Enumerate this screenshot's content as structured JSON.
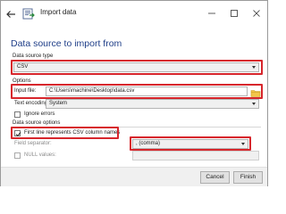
{
  "window": {
    "title": "Import data"
  },
  "heading": "Data source to import from",
  "data_source_type": {
    "section_label": "Data source type",
    "selected": "CSV"
  },
  "options": {
    "section_label": "Options",
    "input_file_label": "Input file:",
    "input_file_value": "C:\\Users\\machine\\Desktop\\data.csv",
    "text_encoding_label": "Text encoding:",
    "text_encoding_value": "System",
    "ignore_errors_label": "Ignore errors"
  },
  "data_source_options": {
    "section_label": "Data source options",
    "first_line_label": "First line represents CSV column names",
    "field_separator_label": "Field separator:",
    "field_separator_value": ", (comma)",
    "null_values_label": "NULL values:",
    "null_values_value": ""
  },
  "footer": {
    "cancel_label": "Cancel",
    "finish_label": "Finish"
  },
  "colors": {
    "accent_heading": "#1f3e88",
    "highlight": "#d7262c"
  },
  "icons": [
    "back-arrow-icon",
    "import-data-icon",
    "minimize-icon",
    "maximize-icon",
    "close-icon",
    "folder-icon",
    "checkmark-icon",
    "chevron-down-icon"
  ]
}
